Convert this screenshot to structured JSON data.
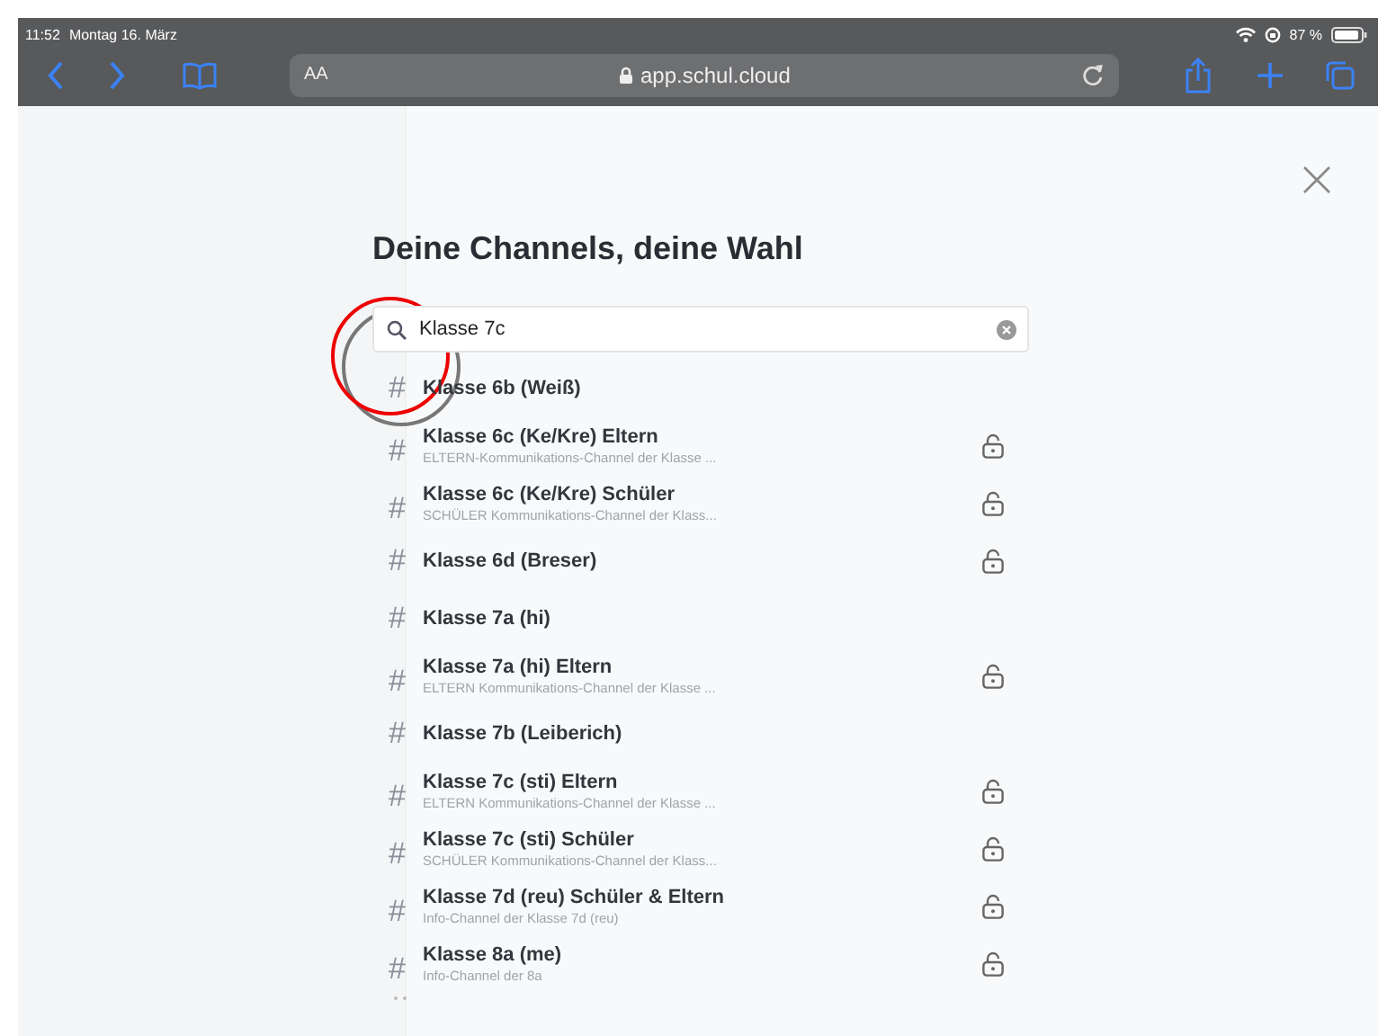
{
  "status_bar": {
    "time": "11:52",
    "date": "Montag 16. März",
    "battery": "87 %"
  },
  "browser": {
    "text_size": "AA",
    "url": "app.schul.cloud"
  },
  "dialog": {
    "title": "Deine Channels, deine Wahl",
    "search": {
      "value": "Klasse 7c"
    },
    "channels": [
      {
        "icon": "#",
        "name": "Klasse 6b (Weiß)",
        "locked": false
      },
      {
        "icon": "#",
        "name": "Klasse 6c (Ke/Kre) Eltern",
        "description": "ELTERN-Kommunikations-Channel der Klasse ...",
        "locked": true
      },
      {
        "icon": "#",
        "name": "Klasse 6c (Ke/Kre) Schüler",
        "description": "SCHÜLER Kommunikations-Channel der Klass...",
        "locked": true
      },
      {
        "icon": "#",
        "name": "Klasse 6d (Breser)",
        "locked": true
      },
      {
        "icon": "#",
        "name": "Klasse 7a (hi)",
        "locked": false
      },
      {
        "icon": "#",
        "name": "Klasse 7a (hi) Eltern",
        "description": "ELTERN Kommunikations-Channel der Klasse ...",
        "locked": true
      },
      {
        "icon": "#",
        "name": "Klasse 7b (Leiberich)",
        "locked": false
      },
      {
        "icon": "#",
        "name": "Klasse 7c (sti) Eltern",
        "description": "ELTERN Kommunikations-Channel der Klasse ...",
        "locked": true
      },
      {
        "icon": "#",
        "name": "Klasse 7c (sti) Schüler",
        "description": "SCHÜLER Kommunikations-Channel der Klass...",
        "locked": true
      },
      {
        "icon": "#",
        "name": "Klasse 7d (reu) Schüler & Eltern",
        "description": "Info-Channel der Klasse 7d (reu)",
        "locked": true
      },
      {
        "icon": "#",
        "name": "Klasse 8a (me)",
        "description": "Info-Channel der 8a",
        "locked": true
      }
    ]
  }
}
